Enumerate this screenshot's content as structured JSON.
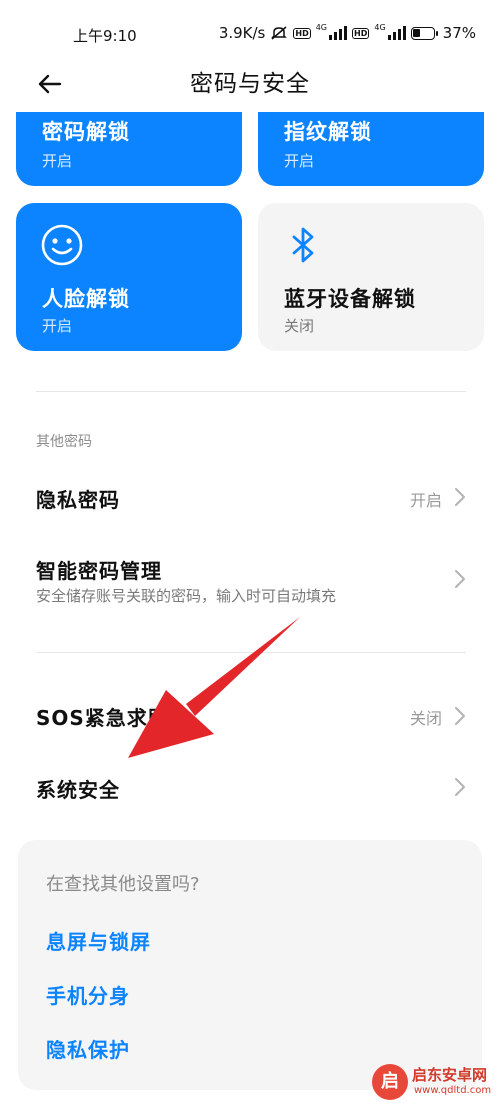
{
  "status_bar": {
    "time": "上午9:10",
    "speed": "3.9K/s",
    "hd": "HD",
    "network": "4G",
    "battery": "37%",
    "battery_level": 0.37
  },
  "header": {
    "title": "密码与安全",
    "back_icon": "arrow-left-icon"
  },
  "tiles": [
    {
      "title": "密码解锁",
      "status": "开启",
      "state": "on"
    },
    {
      "title": "指纹解锁",
      "status": "开启",
      "state": "on"
    },
    {
      "title": "人脸解锁",
      "status": "开启",
      "state": "on",
      "icon": "smiley-face-icon"
    },
    {
      "title": "蓝牙设备解锁",
      "status": "关闭",
      "state": "off",
      "icon": "bluetooth-icon"
    }
  ],
  "other_section": {
    "label": "其他密码",
    "items": [
      {
        "title": "隐私密码",
        "value": "开启"
      },
      {
        "title": "智能密码管理",
        "subtitle": "安全储存账号关联的密码，输入时可自动填充"
      }
    ]
  },
  "misc_items": [
    {
      "title": "SOS紧急求助",
      "value": "关闭"
    },
    {
      "title": "系统安全"
    }
  ],
  "suggestions": {
    "title": "在查找其他设置吗?",
    "links": [
      "息屏与锁屏",
      "手机分身",
      "隐私保护"
    ]
  },
  "watermark": {
    "text": "启东安卓网",
    "url": "www.qdltd.com"
  },
  "colors": {
    "accent": "#0d84ff",
    "annotation_arrow": "#e3262a"
  }
}
